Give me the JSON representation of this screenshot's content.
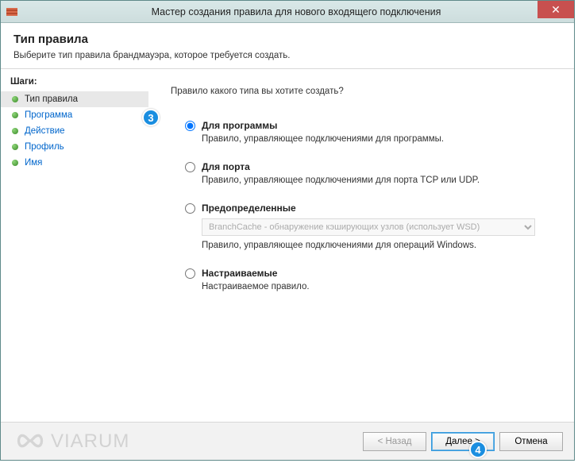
{
  "window": {
    "title": "Мастер создания правила для нового входящего подключения",
    "close_label": "✕"
  },
  "header": {
    "title": "Тип правила",
    "subtitle": "Выберите тип правила брандмауэра, которое требуется создать."
  },
  "sidebar": {
    "steps_header": "Шаги:",
    "steps": [
      {
        "label": "Тип правила"
      },
      {
        "label": "Программа"
      },
      {
        "label": "Действие"
      },
      {
        "label": "Профиль"
      },
      {
        "label": "Имя"
      }
    ]
  },
  "main": {
    "question": "Правило какого типа вы хотите создать?",
    "options": [
      {
        "label": "Для программы",
        "desc": "Правило, управляющее подключениями для программы."
      },
      {
        "label": "Для порта",
        "desc": "Правило, управляющее подключениями для порта TCP или UDP."
      },
      {
        "label": "Предопределенные",
        "desc": "Правило, управляющее подключениями для операций Windows.",
        "select_value": "BranchCache - обнаружение кэширующих узлов (использует WSD)"
      },
      {
        "label": "Настраиваемые",
        "desc": "Настраиваемое правило."
      }
    ]
  },
  "footer": {
    "back": "< Назад",
    "next": "Далее >",
    "cancel": "Отмена"
  },
  "annotations": {
    "badge3": "3",
    "badge4": "4"
  },
  "watermark": {
    "text": "VIARUM"
  }
}
